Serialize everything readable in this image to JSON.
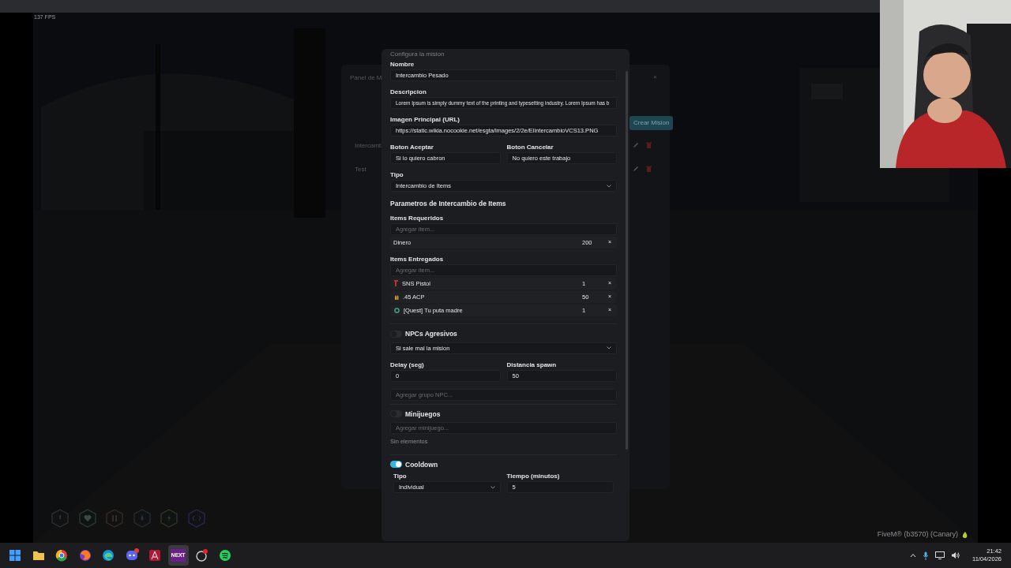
{
  "game_hud": {
    "fps": "137 FPS",
    "build_label": "FiveM® (b3570) (Canary)",
    "status_hexagons": [
      {
        "kind": "alert"
      },
      {
        "kind": "heart"
      },
      {
        "kind": "food"
      },
      {
        "kind": "drop"
      },
      {
        "kind": "bolt"
      },
      {
        "kind": "code"
      }
    ]
  },
  "background_panel": {
    "title": "Panel de M",
    "close": "×",
    "create_button": "Crear Mision",
    "rows": [
      "Intercamb",
      "Test"
    ]
  },
  "modal": {
    "header": "Configura la mision",
    "blocks": [
      {
        "kind": "field",
        "label": "Nombre",
        "value": "Intercambio Pesado"
      },
      {
        "kind": "field",
        "label": "Descripcion",
        "value": "Lorem Ipsum is simply dummy text of the printing and typesetting industry. Lorem Ipsum has b"
      },
      {
        "kind": "field",
        "label": "Imagen Principal (URL)",
        "value": "https://static.wikia.nocookie.net/esgta/images/2/2e/ElintercambioVCS13.PNG"
      },
      {
        "kind": "pair",
        "fields": [
          {
            "kind": "field",
            "label": "Boton Aceptar",
            "value": "Si lo quiero cabron"
          },
          {
            "kind": "field",
            "label": "Boton Cancelar",
            "value": "No quiero este trabajo"
          }
        ]
      },
      {
        "kind": "select",
        "label": "Tipo",
        "value": "Intercambio de Items"
      },
      {
        "kind": "heading",
        "text": "Parametros de Intercambio de Items"
      },
      {
        "kind": "item_list",
        "label": "Items Requeridos",
        "placeholder": "Agregar item...",
        "items": [
          {
            "kind": "plain",
            "name": "Dinero",
            "quantity": "200",
            "remove": "×"
          }
        ]
      },
      {
        "kind": "item_list",
        "label": "Items Entregados",
        "placeholder": "Agregar item...",
        "items": [
          {
            "kind": "weapon",
            "name": "SNS Pistol",
            "quantity": "1",
            "remove": "×"
          },
          {
            "kind": "ammo",
            "name": ".45 ACP",
            "quantity": "50",
            "remove": "×"
          },
          {
            "kind": "quest",
            "name": "[Quest] Tu puta madre",
            "quantity": "1",
            "remove": "×"
          }
        ]
      },
      {
        "kind": "toggle_section",
        "label": "NPCs Agresivos",
        "on": false,
        "body": [
          {
            "kind": "select",
            "value": "Si sale mal la mision"
          },
          {
            "kind": "pair",
            "fields": [
              {
                "kind": "field",
                "label": "Delay (seg)",
                "value": "0"
              },
              {
                "kind": "field",
                "label": "Distancia spawn",
                "value": "50"
              }
            ]
          },
          {
            "kind": "input",
            "placeholder": "Agregar grupo NPC..."
          }
        ]
      },
      {
        "kind": "toggle_section",
        "label": "Minijuegos",
        "on": false,
        "body": [
          {
            "kind": "input",
            "placeholder": "Agregar minijuego..."
          },
          {
            "kind": "note",
            "text": "Sin elementos"
          }
        ]
      },
      {
        "kind": "toggle_section",
        "label": "Cooldown",
        "on": true,
        "body": [
          {
            "kind": "pair",
            "fields": [
              {
                "kind": "select",
                "label": "Tipo",
                "value": "Individual"
              },
              {
                "kind": "field",
                "label": "Tiempo (minutos)",
                "value": "5"
              }
            ]
          }
        ]
      }
    ]
  },
  "taskbar": {
    "apps": [
      {
        "kind": "start"
      },
      {
        "kind": "folder"
      },
      {
        "kind": "chrome"
      },
      {
        "kind": "firefox"
      },
      {
        "kind": "edge"
      },
      {
        "kind": "discord"
      },
      {
        "kind": "redapp"
      },
      {
        "kind": "text",
        "text": "NEXT",
        "selected": true
      },
      {
        "kind": "ghost"
      },
      {
        "kind": "spotify"
      }
    ],
    "time": "21:42",
    "date": "11/04/2026"
  }
}
